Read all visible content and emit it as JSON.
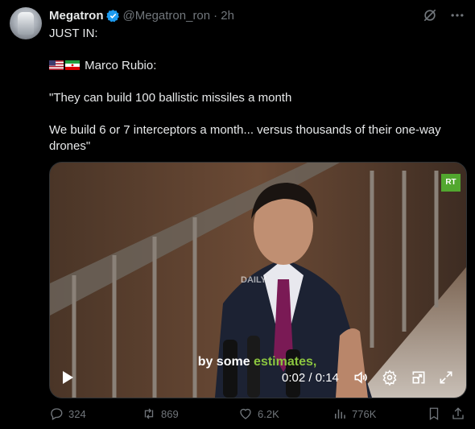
{
  "author": {
    "name": "Megatron",
    "handle": "@Megatron_ron",
    "time": "· 2h"
  },
  "tweet": {
    "line1": "JUST IN:",
    "line2": "Marco Rubio:",
    "line3": "\"They can build 100 ballistic missiles a month",
    "line4": "We build 6 or 7 interceptors a month... versus thousands of their one-way drones\""
  },
  "video": {
    "caption_pre": "by some ",
    "caption_hl": "estimates,",
    "time": "0:02 / 0:14",
    "channel_logo": "RT",
    "watermark": "DAILY"
  },
  "actions": {
    "replies": "324",
    "reposts": "869",
    "likes": "6.2K",
    "views": "776K"
  },
  "colors": {
    "background": "#000000",
    "text": "#e7e9ea",
    "muted": "#71767b",
    "verified": "#1d9bf0",
    "rt_green": "#52a72f"
  }
}
